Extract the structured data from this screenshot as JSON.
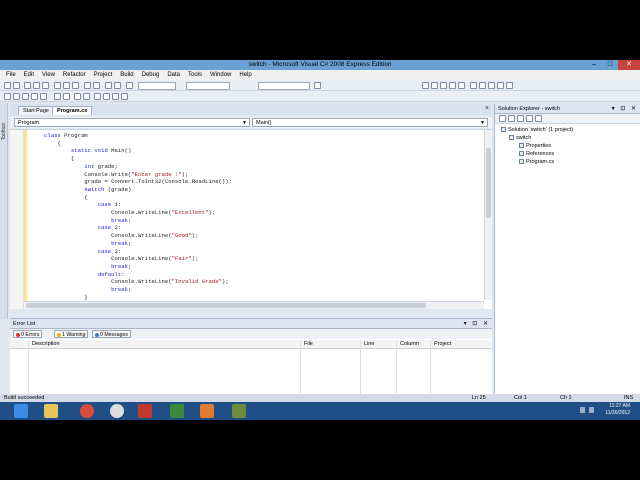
{
  "window": {
    "title": "switch - Microsoft Visual C# 2008 Express Edition"
  },
  "menu": [
    "File",
    "Edit",
    "View",
    "Refactor",
    "Project",
    "Build",
    "Debug",
    "Data",
    "Tools",
    "Window",
    "Help"
  ],
  "left_strip_label": "Toolbox",
  "editor": {
    "tabs": [
      "Start Page",
      "Program.cs"
    ],
    "active_tab": "Program.cs",
    "nav_class": "Program",
    "nav_member": "Main()",
    "code_lines": [
      {
        "t": "class Program"
      },
      {
        "t": "    {"
      },
      {
        "t": "        static void Main()"
      },
      {
        "t": "        {"
      },
      {
        "t": "            int grade;"
      },
      {
        "t": "            Console.Write(\"Enter grade :\");"
      },
      {
        "t": "            grade = Convert.ToInt32(Console.ReadLine());"
      },
      {
        "t": "            switch (grade)"
      },
      {
        "t": "            {"
      },
      {
        "t": "                case 1:"
      },
      {
        "t": "                    Console.WriteLine(\"Excellent\");"
      },
      {
        "t": "                    break;"
      },
      {
        "t": "                case 2:"
      },
      {
        "t": "                    Console.WriteLine(\"Good\");"
      },
      {
        "t": "                    break;"
      },
      {
        "t": "                case 3:"
      },
      {
        "t": "                    Console.WriteLine(\"Fair\");"
      },
      {
        "t": "                    break;"
      },
      {
        "t": "                default:"
      },
      {
        "t": "                    Console.WriteLine(\"Invalid Grade\");"
      },
      {
        "t": "                    break;"
      },
      {
        "t": "            }"
      },
      {
        "t": ""
      }
    ]
  },
  "solution_explorer": {
    "title": "Solution Explorer - switch",
    "items": [
      {
        "label": "Solution 'switch' (1 project)"
      },
      {
        "label": "switch"
      },
      {
        "label": "Properties"
      },
      {
        "label": "References"
      },
      {
        "label": "Program.cs"
      }
    ]
  },
  "error_list": {
    "title": "Error List",
    "tabs": [
      "0 Errors",
      "1 Warning",
      "0 Messages"
    ],
    "columns": [
      "Description",
      "File",
      "Line",
      "Column",
      "Project"
    ]
  },
  "status": {
    "message": "Build succeeded",
    "line": "Ln 25",
    "col": "Col 1",
    "ch": "Ch 1",
    "mode": "INS"
  },
  "taskbar": {
    "time": "11:27 AM",
    "date": "11/30/2012"
  },
  "colors": {
    "titlebar": "#6aa0d4",
    "taskbar": "#1f4f86",
    "keyword": "#1d1dcc",
    "string": "#a31515"
  }
}
